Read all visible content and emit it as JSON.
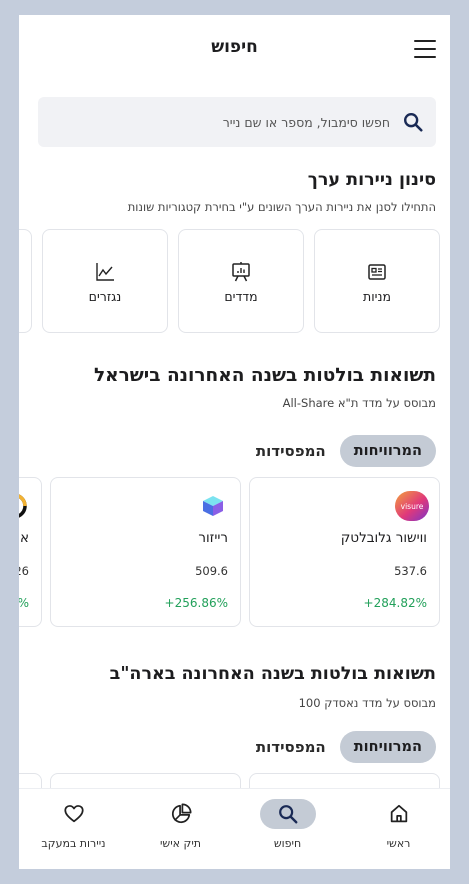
{
  "header": {
    "title": "חיפוש"
  },
  "search": {
    "placeholder": "חפשו סימבול, מספר או שם נייר"
  },
  "filter_section": {
    "title": "סינון ניירות ערך",
    "subtitle": "התחילו לסנן את ניירות הערך השונים ע\"י בחירת קטגוריות שונות",
    "categories": [
      {
        "label": "מניות",
        "icon": "stocks-icon"
      },
      {
        "label": "מדדים",
        "icon": "indices-icon"
      },
      {
        "label": "נגזרים",
        "icon": "derivatives-chart-icon"
      },
      {
        "label": "",
        "icon": ""
      }
    ]
  },
  "israel_section": {
    "title": "תשואות בולטות בשנה האחרונה בישראל",
    "subtitle": "מבוסס על מדד ת\"א All-Share",
    "tabs": {
      "active": "המרוויחות",
      "inactive": "המפסידות"
    },
    "cards": [
      {
        "name": "ווישור גלובלטק",
        "price": "537.6",
        "change": "+284.82%",
        "logo": "visure-logo",
        "logo_text": "visure"
      },
      {
        "name": "רייזור",
        "price": "509.6",
        "change": "+256.86%",
        "logo": "raizor-cube-logo"
      },
      {
        "name": "א",
        "price": "26",
        "change": "%",
        "logo": "partial-ring-logo"
      }
    ]
  },
  "us_section": {
    "title": "תשואות בולטות בשנה האחרונה בארה\"ב",
    "subtitle": "מבוסס על מדד נאסדק 100",
    "tabs": {
      "active": "המרוויחות",
      "inactive": "המפסידות"
    }
  },
  "bottom_nav": [
    {
      "label": "ראשי",
      "icon": "home-icon",
      "active": false
    },
    {
      "label": "חיפוש",
      "icon": "search-icon",
      "active": true
    },
    {
      "label": "תיק אישי",
      "icon": "portfolio-pie-icon",
      "active": false
    },
    {
      "label": "ניירות במעקב",
      "icon": "heart-icon",
      "active": false
    }
  ],
  "colors": {
    "background": "#c4cddc",
    "accent_pill": "#c4cbd5",
    "positive": "#22a05a",
    "search_bg": "#f1f2f5"
  }
}
